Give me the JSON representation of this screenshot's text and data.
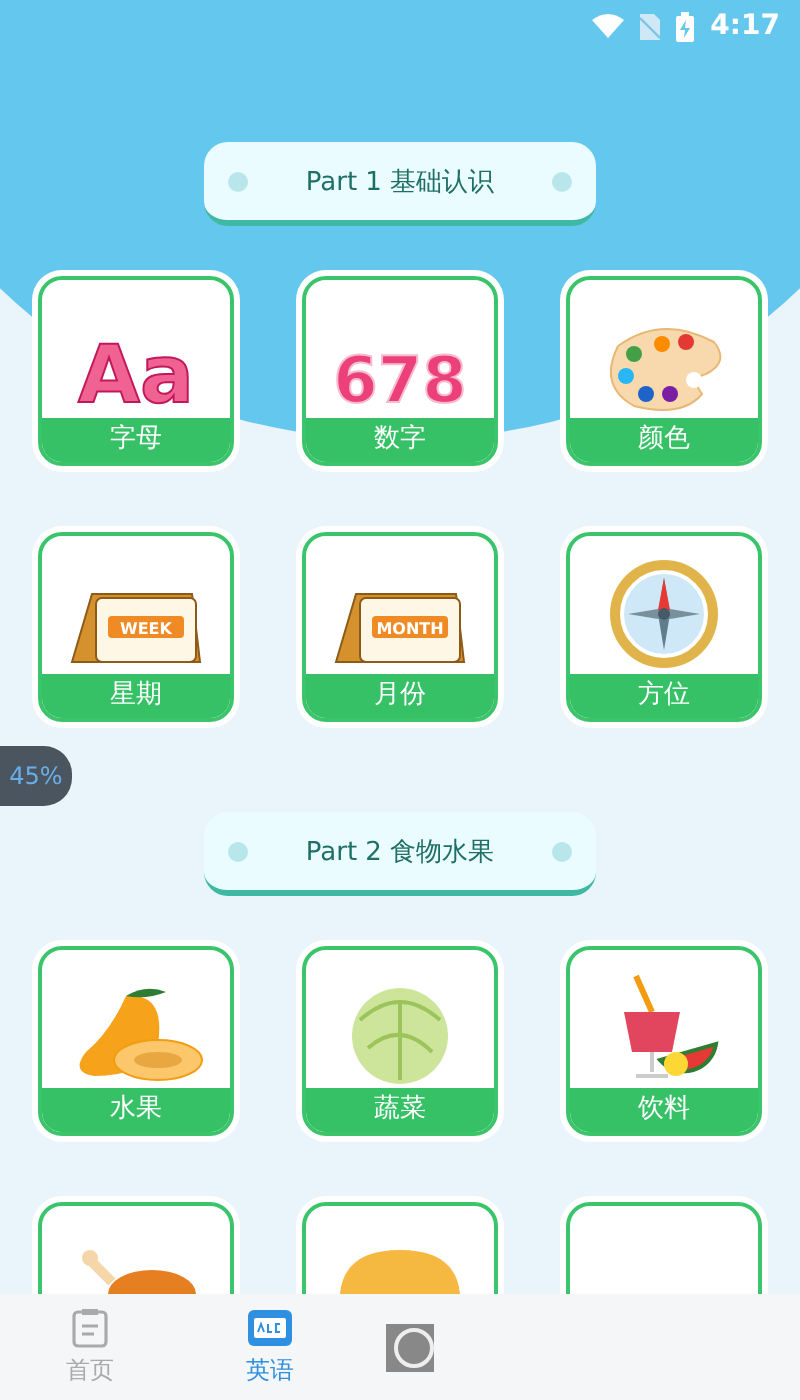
{
  "status_bar": {
    "time": "4:17"
  },
  "sections": [
    {
      "title": "Part 1 基础认识",
      "items": [
        {
          "label": "字母",
          "kind": "letters",
          "art_text": "Aa"
        },
        {
          "label": "数字",
          "kind": "numbers",
          "art_text": "678"
        },
        {
          "label": "颜色",
          "kind": "palette"
        },
        {
          "label": "星期",
          "kind": "calendar",
          "art_text": "WEEK"
        },
        {
          "label": "月份",
          "kind": "calendar",
          "art_text": "MONTH"
        },
        {
          "label": "方位",
          "kind": "compass"
        }
      ]
    },
    {
      "title": "Part 2 食物水果",
      "items": [
        {
          "label": "水果",
          "kind": "mango"
        },
        {
          "label": "蔬菜",
          "kind": "cabbage"
        },
        {
          "label": "饮料",
          "kind": "drink"
        },
        {
          "kind": "meat"
        },
        {
          "kind": "bread"
        },
        {
          "kind": "blank"
        }
      ]
    }
  ],
  "progress_badge": "45%",
  "bottom_nav": [
    {
      "label": "首页",
      "kind": "home",
      "selected": false
    },
    {
      "label": "英语",
      "kind": "english",
      "selected": true
    },
    {
      "kind": "other",
      "selected": false
    }
  ]
}
